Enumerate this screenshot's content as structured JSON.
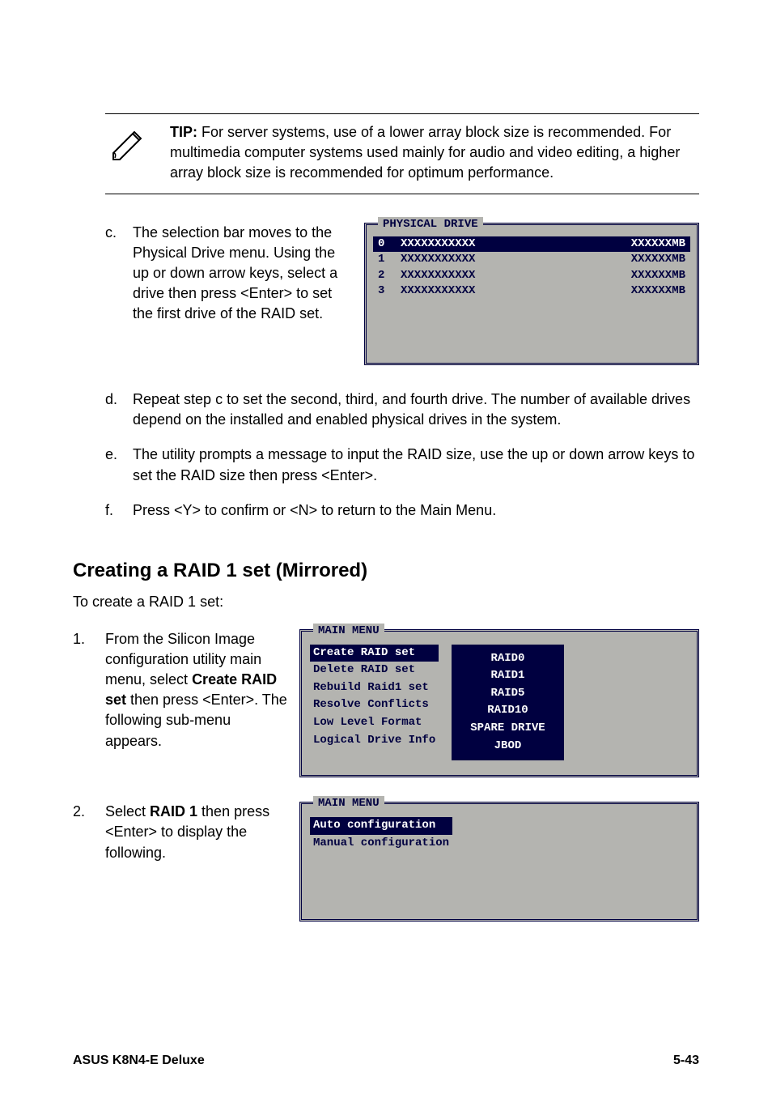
{
  "tip": {
    "label": "TIP:",
    "text": " For server systems, use of a lower array block size is recommended. For multimedia computer systems used mainly for audio and video editing, a higher array block size is recommended for optimum performance."
  },
  "step_c": {
    "marker": "c.",
    "text": "The selection bar moves to the Physical Drive menu. Using the up or down arrow keys, select a drive then press <Enter> to set the first drive of the RAID set."
  },
  "physical_panel": {
    "label": "PHYSICAL DRIVE",
    "rows": [
      {
        "idx": "0",
        "name": "XXXXXXXXXXX",
        "size": "XXXXXXMB",
        "selected": true
      },
      {
        "idx": "1",
        "name": "XXXXXXXXXXX",
        "size": "XXXXXXMB",
        "selected": false
      },
      {
        "idx": "2",
        "name": "XXXXXXXXXXX",
        "size": "XXXXXXMB",
        "selected": false
      },
      {
        "idx": "3",
        "name": "XXXXXXXXXXX",
        "size": "XXXXXXMB",
        "selected": false
      }
    ]
  },
  "step_d": {
    "marker": "d.",
    "text": "Repeat step c to set the second, third, and fourth drive. The number of available drives depend on the installed and enabled physical drives in the system."
  },
  "step_e": {
    "marker": "e.",
    "text": "The utility prompts a message to input the RAID size, use the up or down arrow keys to set the RAID size then press <Enter>."
  },
  "step_f": {
    "marker": "f.",
    "text": "Press <Y> to confirm or <N> to return to the Main Menu."
  },
  "heading_mirror": "Creating a RAID 1 set (Mirrored)",
  "intro_mirror": "To create a RAID 1 set:",
  "step1": {
    "marker": "1.",
    "text_before": "From the Silicon Image configuration utility main menu, select ",
    "bold": "Create RAID set",
    "text_after": " then press <Enter>. The following sub-menu appears."
  },
  "main_menu_panel": {
    "label": "MAIN MENU",
    "items": [
      {
        "label": "Create RAID set",
        "selected": true
      },
      {
        "label": "Delete RAID set",
        "selected": false
      },
      {
        "label": "Rebuild Raid1 set",
        "selected": false
      },
      {
        "label": "Resolve Conflicts",
        "selected": false
      },
      {
        "label": "Low Level Format",
        "selected": false
      },
      {
        "label": "Logical Drive Info",
        "selected": false
      }
    ],
    "raid_popup": [
      "RAID0",
      "RAID1",
      "RAID5",
      "RAID10",
      "SPARE DRIVE",
      "JBOD"
    ]
  },
  "step2": {
    "marker": "2.",
    "text_before": "Select ",
    "bold": "RAID 1",
    "text_after": " then press <Enter> to display the following."
  },
  "main_menu_panel2": {
    "label": "MAIN MENU",
    "items": [
      {
        "label": "Auto configuration",
        "selected": true
      },
      {
        "label": "Manual configuration",
        "selected": false
      }
    ]
  },
  "footer": {
    "left": "ASUS K8N4-E Deluxe",
    "right": "5-43"
  }
}
